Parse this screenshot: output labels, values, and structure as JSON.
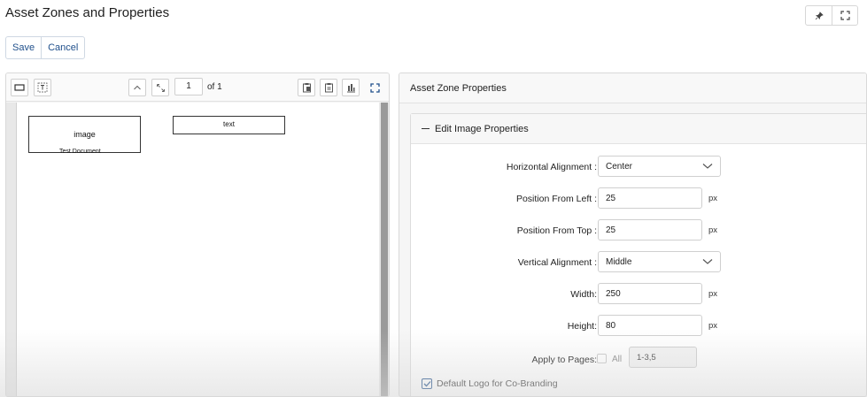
{
  "page": {
    "title": "Asset Zones and Properties"
  },
  "actions": {
    "save_label": "Save",
    "cancel_label": "Cancel"
  },
  "top_tools": {
    "icons": [
      "pin-icon",
      "fullscreen-icon"
    ]
  },
  "viewer": {
    "current_page": "1",
    "page_of": "of 1",
    "zones": {
      "image_label": "image",
      "text_label": "text"
    },
    "caption": "Test Document"
  },
  "properties": {
    "header": "Asset Zone Properties",
    "section_title": "Edit Image Properties",
    "horizontal_alignment": {
      "label": "Horizontal Alignment :",
      "value": "Center"
    },
    "position_left": {
      "label": "Position From Left :",
      "value": "25",
      "unit": "px"
    },
    "position_top": {
      "label": "Position From Top :",
      "value": "25",
      "unit": "px"
    },
    "vertical_alignment": {
      "label": "Vertical Alignment :",
      "value": "Middle"
    },
    "width": {
      "label": "Width:",
      "value": "250",
      "unit": "px"
    },
    "height": {
      "label": "Height:",
      "value": "80",
      "unit": "px"
    },
    "apply_pages": {
      "label": "Apply to Pages:",
      "all_label": "All",
      "value": "1-3,5"
    },
    "default_logo": {
      "label": "Default Logo for Co-Branding",
      "checked": true
    }
  },
  "colors": {
    "accent": "#1f4f8b",
    "border": "#d9d9d9",
    "panel_bg": "#f6f6f6"
  }
}
